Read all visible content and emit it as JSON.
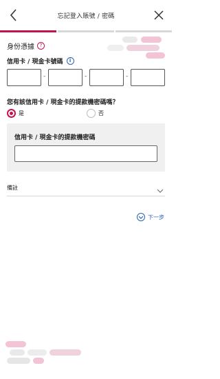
{
  "header": {
    "title": "忘記登入賬號 / 密碼"
  },
  "progress": {
    "total_steps": 3,
    "current_step": 1
  },
  "identity": {
    "section_title": "身份憑據",
    "card_number_label": "信用卡 / 現金卡號碼",
    "card_separator": "-"
  },
  "pin_question": {
    "question": "您有該信用卡 / 現金卡的提款機密碼嗎？",
    "options": [
      {
        "label": "是",
        "selected": true
      },
      {
        "label": "否",
        "selected": false
      }
    ]
  },
  "pin_field": {
    "label": "信用卡 / 現金卡的提款機密碼",
    "value": ""
  },
  "remarks": {
    "label": "備註"
  },
  "next": {
    "label": "下一步"
  },
  "colors": {
    "accent": "#c4124e",
    "link": "#2a5fb8",
    "decor_pink": "#f3c4d6",
    "decor_gray": "#e6e6e6"
  }
}
